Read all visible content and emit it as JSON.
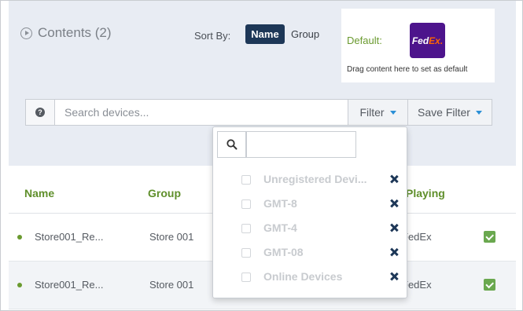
{
  "contents": {
    "title": "Contents (2)"
  },
  "sort": {
    "label": "Sort By:",
    "options": [
      "Name",
      "Group"
    ],
    "active": "Name"
  },
  "default_panel": {
    "label": "Default:",
    "hint": "Drag content here to set as default"
  },
  "logo": {
    "fed": "Fed",
    "ex": "Ex."
  },
  "search": {
    "placeholder": "Search devices...",
    "filter_label": "Filter",
    "save_filter_label": "Save Filter"
  },
  "table": {
    "columns": [
      "Name",
      "Group",
      "Playing"
    ],
    "rows": [
      {
        "name": "Store001_Re...",
        "group": "Store 001",
        "playing": "FedEx",
        "checked": true
      },
      {
        "name": "Store001_Re...",
        "group": "Store 001",
        "playing": "FedEx",
        "checked": true
      }
    ]
  },
  "filter_dropdown": {
    "search_value": "",
    "items": [
      {
        "label": "Unregistered Devi...",
        "checked": false
      },
      {
        "label": "GMT-8",
        "checked": false
      },
      {
        "label": "GMT-4",
        "checked": false
      },
      {
        "label": "GMT-08",
        "checked": false
      },
      {
        "label": "Online Devices",
        "checked": false
      }
    ]
  },
  "colors": {
    "accent_green": "#6a9a2f",
    "navy": "#1d3757",
    "panel_bg": "#e8ecf3",
    "caret_blue": "#2a8fd6",
    "fedex_purple": "#4d148c",
    "fedex_orange": "#ff6600"
  }
}
